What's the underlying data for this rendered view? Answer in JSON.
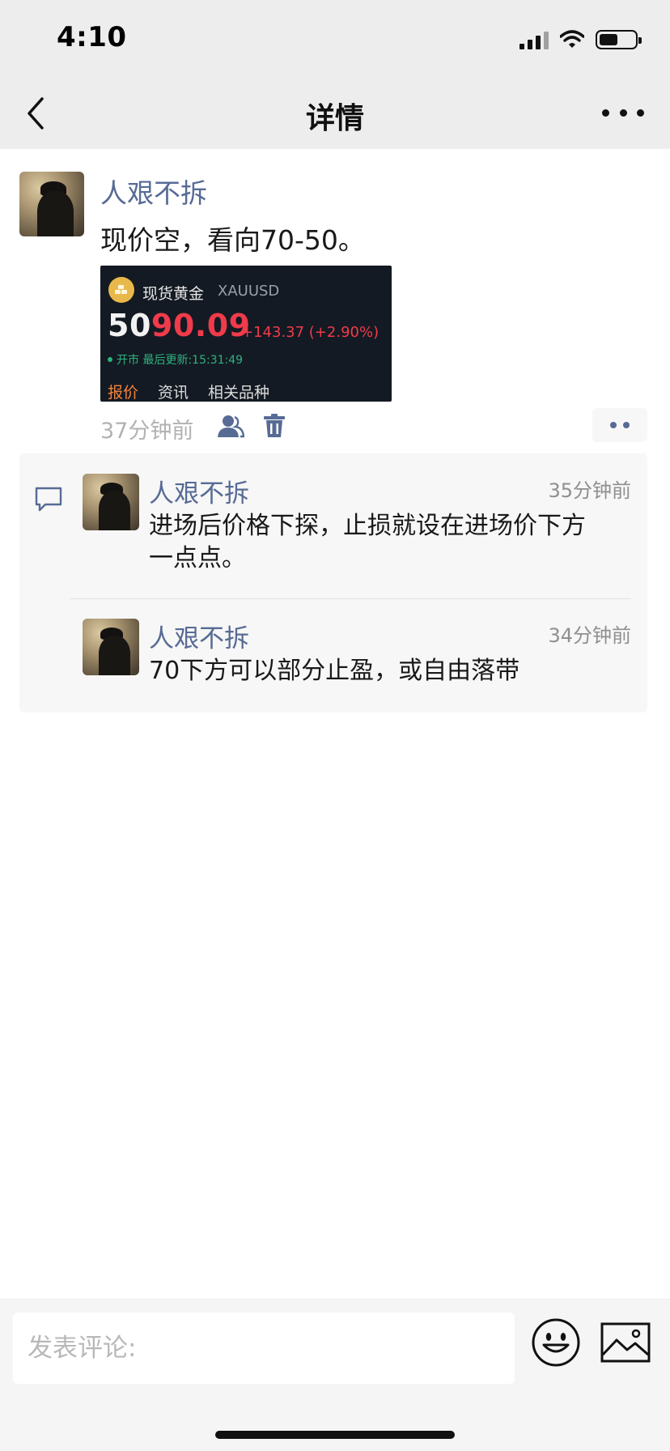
{
  "status_bar": {
    "time": "4:10"
  },
  "nav": {
    "title": "详情"
  },
  "post": {
    "author": "人艰不拆",
    "text": "现价空，看向70-50。",
    "time": "37分钟前",
    "quote_card": {
      "name": "现货黄金",
      "code": "XAUUSD",
      "price_prefix": "50",
      "price_suffix": "90.09",
      "change": "+143.37 (+2.90%)",
      "status": "开市 最后更新:15:31:49",
      "tabs": [
        "报价",
        "资讯",
        "相关品种"
      ]
    }
  },
  "comments": [
    {
      "author": "人艰不拆",
      "time": "35分钟前",
      "text_line1": "进场后价格下探，止损就设在进场价下方",
      "text_line2": "一点点。"
    },
    {
      "author": "人艰不拆",
      "time": "34分钟前",
      "text_line1": "70下方可以部分止盈，或自由落带"
    }
  ],
  "input": {
    "placeholder": "发表评论:"
  },
  "colors": {
    "link": "#576b95",
    "nav_bg": "#ededed",
    "price_red": "#ef3b4a",
    "tab_active": "#f5843c"
  }
}
